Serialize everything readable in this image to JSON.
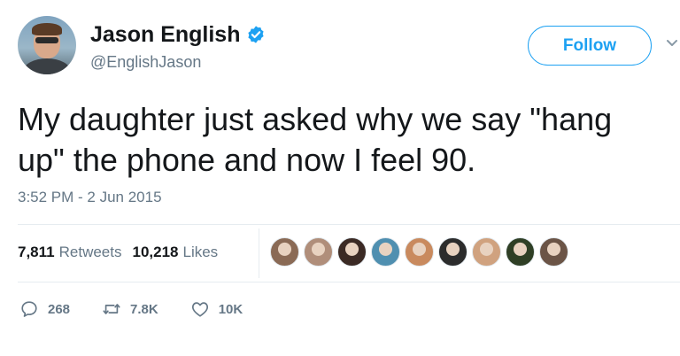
{
  "user": {
    "display_name": "Jason English",
    "handle": "@EnglishJason",
    "verified_icon": "verified-badge-icon",
    "verified_color": "#1da1f2"
  },
  "follow_button": {
    "label": "Follow"
  },
  "tweet": {
    "text": "My daughter just asked why we say \"hang\nup\" the phone and now I feel 90.",
    "timestamp": "3:52 PM - 2 Jun 2015"
  },
  "stats": {
    "retweets_count": "7,811",
    "retweets_label": "Retweets",
    "likes_count": "10,218",
    "likes_label": "Likes"
  },
  "likers": [
    {
      "name": "liker-avatar-1",
      "color": "#8a6a55"
    },
    {
      "name": "liker-avatar-2",
      "color": "#b08e7a"
    },
    {
      "name": "liker-avatar-3",
      "color": "#3b2a24"
    },
    {
      "name": "liker-avatar-4",
      "color": "#4f8fb0"
    },
    {
      "name": "liker-avatar-5",
      "color": "#c98a5e"
    },
    {
      "name": "liker-avatar-6",
      "color": "#2c2c2c"
    },
    {
      "name": "liker-avatar-7",
      "color": "#d0a27f"
    },
    {
      "name": "liker-avatar-8",
      "color": "#2f3f25"
    },
    {
      "name": "liker-avatar-9",
      "color": "#6b5446"
    }
  ],
  "actions": {
    "reply_count": "268",
    "retweet_count": "7.8K",
    "like_count": "10K"
  },
  "colors": {
    "accent": "#1da1f2",
    "text_primary": "#14171a",
    "text_secondary": "#657786",
    "divider": "#e6ecf0"
  }
}
